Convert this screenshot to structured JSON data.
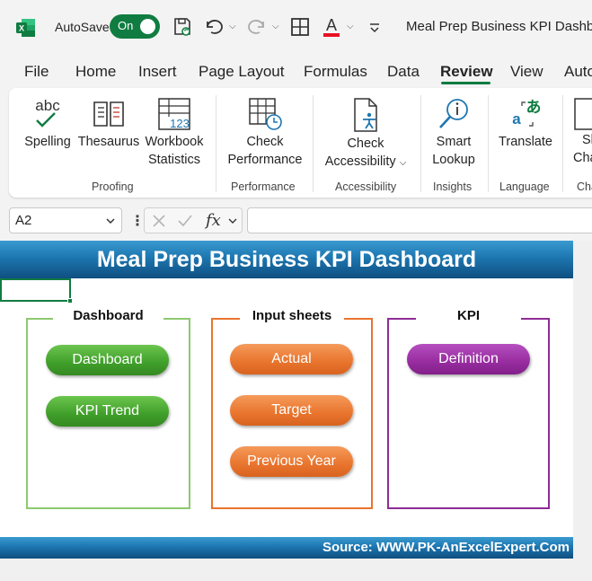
{
  "titlebar": {
    "autosave_label": "AutoSave",
    "autosave_state": "On",
    "document_title": "Meal Prep Business KPI Dashb..."
  },
  "tabs": [
    "File",
    "Home",
    "Insert",
    "Page Layout",
    "Formulas",
    "Data",
    "Review",
    "View",
    "Auto"
  ],
  "active_tab": "Review",
  "ribbon": {
    "groups": {
      "proofing": "Proofing",
      "performance": "Performance",
      "accessibility": "Accessibility",
      "insights": "Insights",
      "language": "Language",
      "changes": "Cha"
    },
    "buttons": {
      "spelling": "Spelling",
      "spelling_icon_text": "abc",
      "thesaurus": "Thesaurus",
      "workbook_statistics_1": "Workbook",
      "workbook_statistics_2": "Statistics",
      "workbook_statistics_icon_text": "123",
      "check_performance_1": "Check",
      "check_performance_2": "Performance",
      "check_accessibility_1": "Check",
      "check_accessibility_2": "Accessibility",
      "smart_lookup_1": "Smart",
      "smart_lookup_2": "Lookup",
      "translate": "Translate",
      "show_changes_1": "Sh",
      "show_changes_2": "Cha"
    }
  },
  "formula_bar": {
    "name_box": "A2",
    "fx_label": "fx",
    "formula": ""
  },
  "dashboard": {
    "title": "Meal Prep Business KPI Dashboard",
    "panels": {
      "dashboard": {
        "title": "Dashboard",
        "buttons": [
          "Dashboard",
          "KPI Trend"
        ]
      },
      "input_sheets": {
        "title": "Input sheets",
        "buttons": [
          "Actual",
          "Target",
          "Previous Year"
        ]
      },
      "kpi": {
        "title": "KPI",
        "buttons": [
          "Definition"
        ]
      }
    },
    "footer": "Source: WWW.PK-AnExcelExpert.Com"
  },
  "colors": {
    "excel_green": "#107c41",
    "header_blue": "#1d76b0",
    "panel_green": "#8dc96f",
    "panel_orange": "#e8742d",
    "panel_purple": "#8e2c96",
    "pill_green": "#3f9e2a",
    "pill_orange": "#e8742d",
    "pill_purple": "#972c9f"
  }
}
